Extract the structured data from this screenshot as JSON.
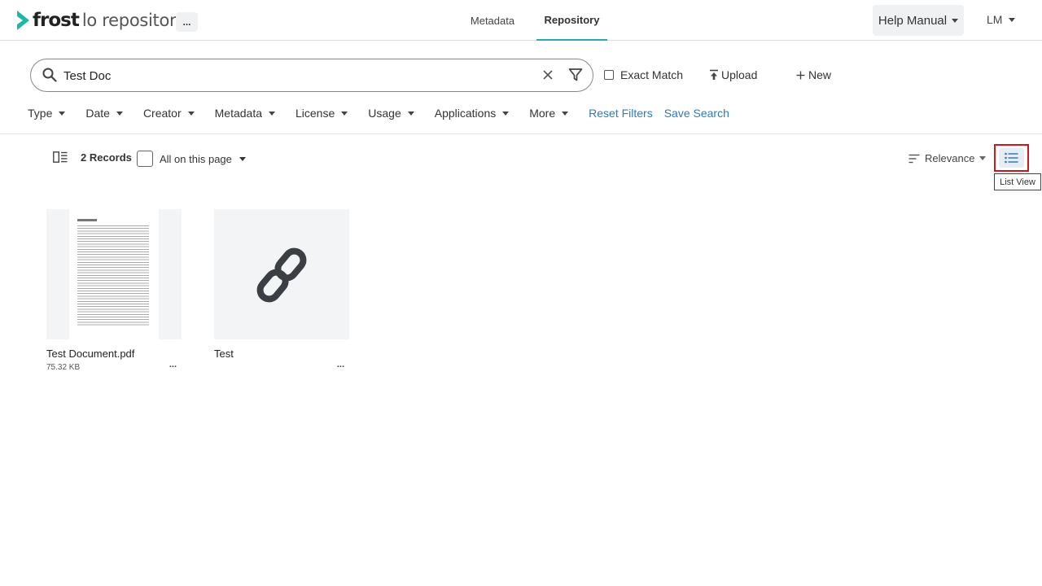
{
  "header": {
    "logo_brand": "frost",
    "logo_suffix": "lo repository",
    "more_label": "...",
    "tabs": [
      {
        "label": "Metadata",
        "active": false
      },
      {
        "label": "Repository",
        "active": true
      }
    ],
    "help_label": "Help Manual",
    "user_initials": "LM"
  },
  "search": {
    "value": "Test Doc",
    "exact_match_label": "Exact Match",
    "upload_label": "Upload",
    "new_label": "New"
  },
  "filters": {
    "items": [
      "Type",
      "Date",
      "Creator",
      "Metadata",
      "License",
      "Usage",
      "Applications",
      "More"
    ],
    "reset_label": "Reset Filters",
    "save_label": "Save Search"
  },
  "toolbar": {
    "records_label": "2 Records",
    "select_all_label": "All on this page",
    "sort_label": "Relevance",
    "list_view_tooltip": "List View"
  },
  "items": [
    {
      "name": "Test Document.pdf",
      "size": "75.32 KB",
      "menu": "...",
      "kind": "document-pdf"
    },
    {
      "name": "Test",
      "size": "",
      "menu": "...",
      "kind": "link"
    }
  ],
  "colors": {
    "accent": "#2aa8b5",
    "link": "#2b7bbf",
    "highlight": "#d0161b",
    "logo": "#1fb6a8"
  }
}
